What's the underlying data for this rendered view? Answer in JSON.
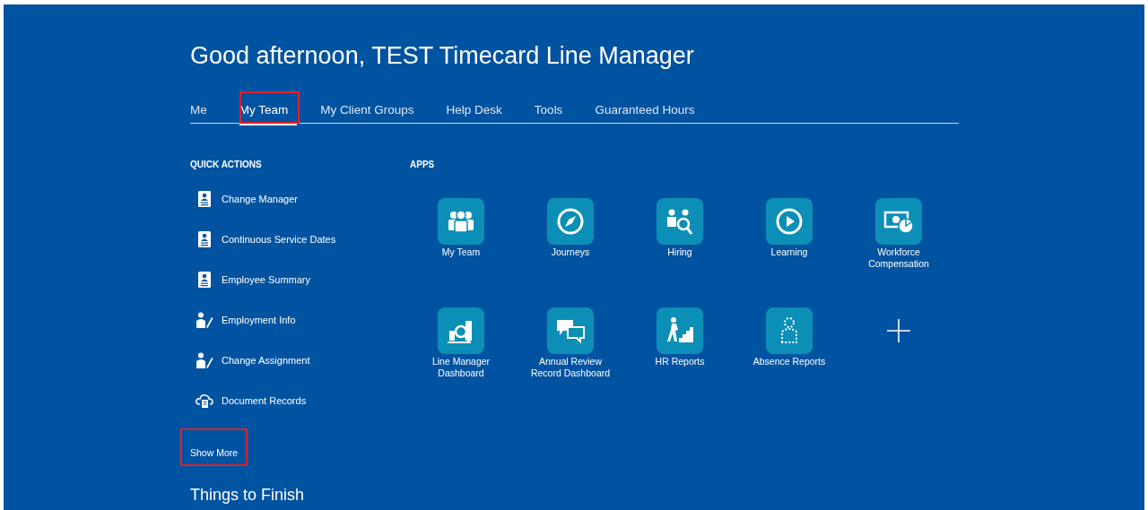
{
  "greeting": "Good afternoon, TEST Timecard Line Manager",
  "tabs": [
    {
      "label": "Me",
      "selected": false,
      "highlighted": false
    },
    {
      "label": "My Team",
      "selected": true,
      "highlighted": true
    },
    {
      "label": "My Client Groups",
      "selected": false,
      "highlighted": false
    },
    {
      "label": "Help Desk",
      "selected": false,
      "highlighted": false
    },
    {
      "label": "Tools",
      "selected": false,
      "highlighted": false
    },
    {
      "label": "Guaranteed Hours",
      "selected": false,
      "highlighted": false
    }
  ],
  "quick_actions": {
    "heading": "QUICK ACTIONS",
    "items": [
      {
        "label": "Change Manager",
        "kind": "badge"
      },
      {
        "label": "Continuous Service Dates",
        "kind": "badge"
      },
      {
        "label": "Employee Summary",
        "kind": "badge"
      },
      {
        "label": "Employment Info",
        "kind": "person-edit"
      },
      {
        "label": "Change Assignment",
        "kind": "person-edit"
      },
      {
        "label": "Document Records",
        "kind": "cloud-doc"
      }
    ],
    "show_more": {
      "label": "Show More",
      "highlighted": true
    }
  },
  "apps": {
    "heading": "APPS",
    "items": [
      {
        "kind": "team",
        "label": "My Team"
      },
      {
        "kind": "compass",
        "label": "Journeys"
      },
      {
        "kind": "hiring",
        "label": "Hiring"
      },
      {
        "kind": "play",
        "label": "Learning"
      },
      {
        "kind": "money",
        "label": "Workforce Compensation"
      },
      {
        "kind": "dashboard",
        "label": "Line Manager Dashboard"
      },
      {
        "kind": "chat",
        "label": "Annual Review Record Dashboard"
      },
      {
        "kind": "stairs",
        "label": "HR Reports"
      },
      {
        "kind": "dashed-person",
        "label": "Absence Reports"
      },
      {
        "kind": "add"
      }
    ]
  },
  "next_section": {
    "title": "Things to Finish"
  }
}
